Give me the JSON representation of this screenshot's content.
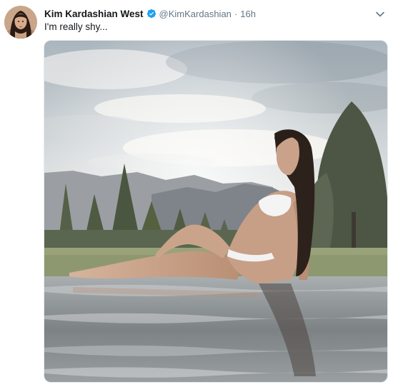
{
  "tweet": {
    "author": {
      "display_name": "Kim Kardashian West",
      "handle": "@KimKardashian",
      "verified": true
    },
    "separator": "·",
    "timestamp": "16h",
    "text": "I'm really shy...",
    "media": {
      "type": "photo"
    }
  },
  "icons": {
    "verified": "verified-badge-icon",
    "caret": "chevron-down-icon"
  },
  "colors": {
    "name_text": "#14171a",
    "secondary_text": "#657786",
    "verified_blue": "#1da1f2"
  }
}
